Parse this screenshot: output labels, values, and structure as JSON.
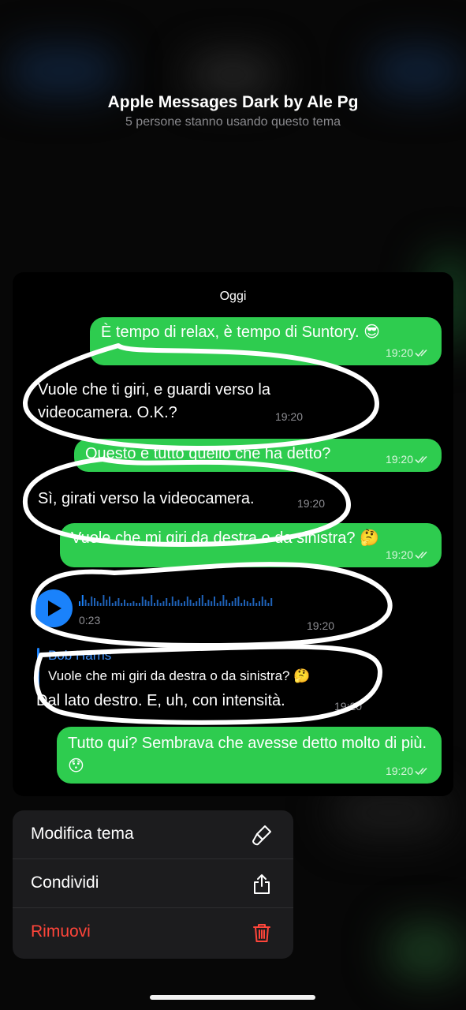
{
  "header": {
    "title": "Apple Messages Dark by Ale Pg",
    "subtitle": "5 persone stanno usando questo tema"
  },
  "chat": {
    "date_label": "Oggi",
    "messages": [
      {
        "dir": "out",
        "text": "È tempo di relax, è tempo di Suntory. 😎",
        "time": "19:20",
        "read": true
      },
      {
        "dir": "in",
        "text": "Vuole che ti giri, e guardi verso la videocamera. O.K.?",
        "time": "19:20"
      },
      {
        "dir": "out",
        "text": "Questo è tutto quello che ha detto?",
        "time": "19:20",
        "read": true
      },
      {
        "dir": "in",
        "text": "Sì, girati verso la videocamera.",
        "time": "19:20"
      },
      {
        "dir": "out",
        "text": "Vuole che mi giri da destra o da sinistra? 🤔",
        "time": "19:20",
        "read": true
      },
      {
        "dir": "in",
        "type": "voice",
        "duration": "0:23",
        "time": "19:20"
      },
      {
        "dir": "in",
        "reply_author": "Bob Harris",
        "reply_text": "Vuole che mi giri da destra o da sinistra? 🤔",
        "text": "Dal lato destro. E, uh, con intensità.",
        "time": "19:20"
      },
      {
        "dir": "out",
        "text": "Tutto qui? Sembrava che avesse detto molto di più. 😯",
        "time": "19:20",
        "read": true
      }
    ]
  },
  "menu": {
    "items": [
      {
        "label": "Modifica tema",
        "icon": "brush-icon"
      },
      {
        "label": "Condividi",
        "icon": "share-icon"
      },
      {
        "label": "Rimuovi",
        "icon": "trash-icon",
        "destructive": true
      }
    ]
  },
  "colors": {
    "outgoing_bubble": "#2ecc4f",
    "incoming_bubble": "#000000",
    "accent_blue": "#1a82fb",
    "destructive": "#ff453a",
    "menu_background": "#1c1c1e",
    "annotation_stroke": "#ffffff"
  }
}
